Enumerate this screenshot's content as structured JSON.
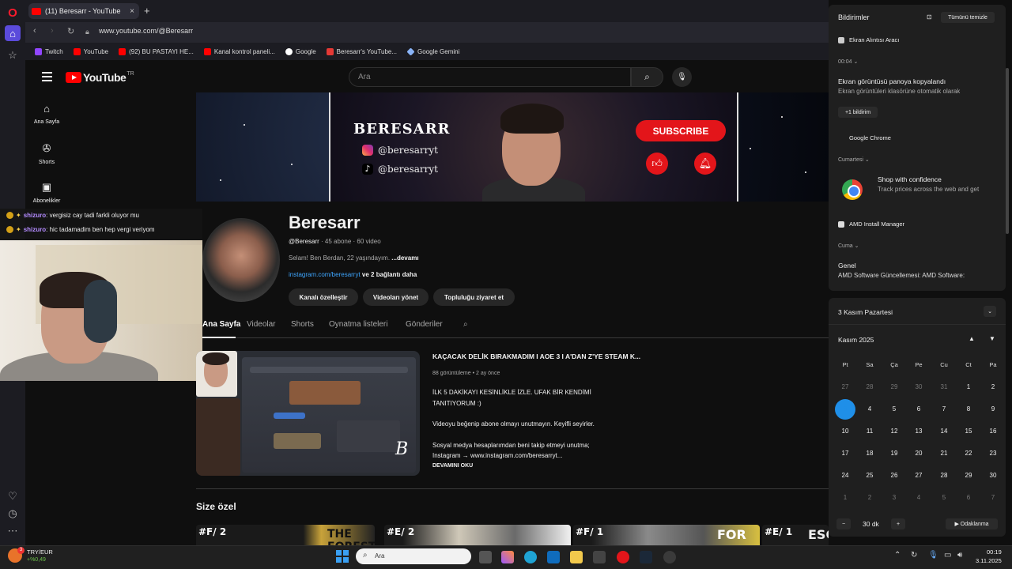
{
  "browser": {
    "tab_title": "(11) Beresarr - YouTube",
    "new_tab": "+",
    "url": "www.youtube.com/@Beresarr",
    "bookmarks": [
      "Twitch",
      "YouTube",
      "(92) BU PASTAYI HE...",
      "Kanal kontrol paneli...",
      "Google",
      "Beresarr's YouTube...",
      "Google Gemini"
    ],
    "bookmark_colors": [
      "#9146ff",
      "#ff0000",
      "#ff0000",
      "#ff0000",
      "#ffffff",
      "#e53935",
      "#8ab4f8"
    ]
  },
  "youtube": {
    "logo": "YouTube",
    "region": "TR",
    "search_placeholder": "Ara",
    "nav": [
      {
        "label": "Ana Sayfa",
        "icon": "home-icon"
      },
      {
        "label": "Shorts",
        "icon": "shorts-icon"
      },
      {
        "label": "Abonelikler",
        "icon": "subscriptions-icon"
      }
    ]
  },
  "chat": [
    {
      "user": "shizuro",
      "text": ": vergisiz cay tadi farkli oluyor mu"
    },
    {
      "user": "shizuro",
      "text": ": hic tadamadim ben hep vergi veriyom"
    }
  ],
  "banner": {
    "name": "BERESARR",
    "instagram": "@beresarryt",
    "tiktok": "@beresarryt",
    "subscribe": "SUBSCRIBE"
  },
  "channel": {
    "name": "Beresarr",
    "handle": "@Beresarr",
    "subs": "· 45 abone · 60 video",
    "description": "Selam! Ben Berdan, 22 yaşındayım. ",
    "more": "...devamı",
    "link": "instagram.com/beresarryt",
    "link_more": " ve 2 bağlantı daha",
    "buttons": [
      "Kanalı özelleştir",
      "Videoları yönet",
      "Topluluğu ziyaret et"
    ],
    "tabs": [
      "Ana Sayfa",
      "Videolar",
      "Shorts",
      "Oynatma listeleri",
      "Gönderiler"
    ]
  },
  "featured": {
    "title": "KAÇACAK DELİK BIRAKMADIM I AOE 3 I A'DAN Z'YE STEAM K...",
    "meta": "88 görüntüleme • 2 ay önce",
    "desc1": "İLK 5 DAKİKAYI KESİNLİKLE İZLE. UFAK BİR KENDİMİ",
    "desc2": "TANITIYORUM :)",
    "desc3": "Videoyu beğenip abone olmayı unutmayın. Keyifli seyirler.",
    "desc4": "Sosyal medya hesaplarımdan beni takip etmeyi unutma;",
    "desc5": "Instagram → www.instagram.com/beresarryt...",
    "more": "DEVAMINI OKU",
    "watermark": "B"
  },
  "section_title": "Size özel",
  "shelf": [
    {
      "label": "#F/ 2",
      "extra": "THE FOREST"
    },
    {
      "label": "#E/ 2",
      "extra": ""
    },
    {
      "label": "#F/ 1",
      "extra": "FOR"
    },
    {
      "label": "#E/ 1",
      "extra": "ESCAPE"
    }
  ],
  "notifications": {
    "header": "Bildirimler",
    "clear_all": "Tümünü temizle",
    "app1": "Ekran Alıntısı Aracı",
    "time1": "00:04",
    "n1_title": "Ekran görüntüsü panoya kopyalandı",
    "n1_body": "Ekran görüntüleri klasörüne otomatik olarak",
    "plus_one": "+1 bildirim",
    "app2": "Google Chrome",
    "day2": "Cumartesi",
    "n2_title": "Shop with confidence",
    "n2_body": "Track prices across the web and get",
    "app3": "AMD Install Manager",
    "day3": "Cuma",
    "n3_title": "Genel",
    "n3_body": "AMD Software Güncellemesi: AMD Software:"
  },
  "calendar": {
    "date_header": "3 Kasım Pazartesi",
    "month": "Kasım 2025",
    "weekdays": [
      "Pt",
      "Sa",
      "Ça",
      "Pe",
      "Cu",
      "Ct",
      "Pa"
    ],
    "focus_minutes": "30 dk",
    "focus_button": "Odaklanma",
    "today": 3
  },
  "taskbar": {
    "ticker": "TRY/EUR",
    "ticker_change": "+%0,49",
    "badge": "3",
    "search": "Ara",
    "time": "00:19",
    "date": "3.11.2025"
  }
}
